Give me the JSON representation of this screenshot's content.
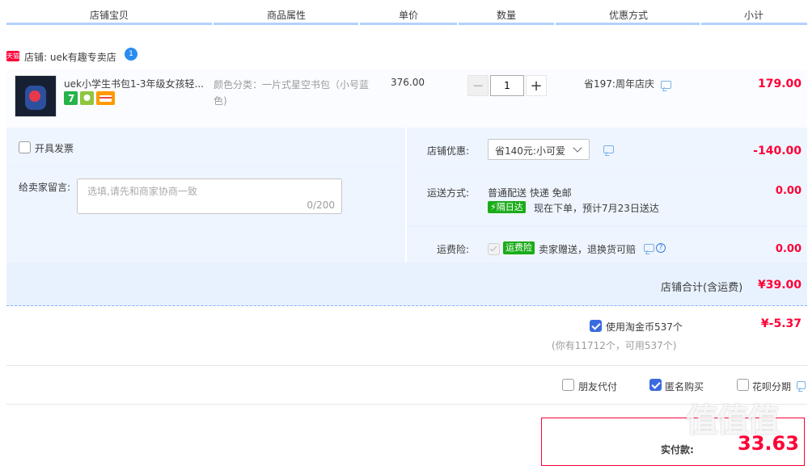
{
  "header": {
    "columns": [
      "店铺宝贝",
      "商品属性",
      "单价",
      "数量",
      "优惠方式",
      "小计"
    ]
  },
  "shop": {
    "badge": "天猫",
    "name": "店铺: uek有趣专卖店",
    "ww_icon": "1"
  },
  "item": {
    "title": "uek小学生书包1-3年级女孩轻...",
    "props": "颜色分类：一片式星空书包（小号蓝色)",
    "price": "376.00",
    "qty_minus": "−",
    "qty_value": "1",
    "qty_plus": "+",
    "promo": "省197:周年店庆",
    "subtotal": "179.00"
  },
  "invoice": {
    "label": "开具发票"
  },
  "message": {
    "label": "给卖家留言:",
    "placeholder": "选填,请先和商家协商一致",
    "counter": "0/200"
  },
  "shop_discount": {
    "label": "店铺优惠:",
    "selected": "省140元:小可爱",
    "amount": "-140.00"
  },
  "shipping": {
    "label": "运送方式:",
    "method": "普通配送 快递 免邮",
    "badge": "隔日达",
    "note": "现在下单，预计7月23日送达",
    "amount": "0.00"
  },
  "insurance": {
    "label": "运费险:",
    "badge": "运费险",
    "text": "卖家赠送，退换货可赔",
    "help": "?",
    "amount": "0.00"
  },
  "shop_total": {
    "label": "店铺合计(含运费)",
    "amount": "¥39.00"
  },
  "coins": {
    "label": "使用淘金币537个",
    "sub": "(你有11712个，可用537个)",
    "amount": "¥-5.37"
  },
  "options": {
    "friend_pay": "朋友代付",
    "anonymous": "匿名购买",
    "huabei": "花呗分期"
  },
  "pay": {
    "label": "实付款:",
    "amount": "33.63"
  },
  "watermark": "值值值",
  "colors": {
    "accent": "#ff0036",
    "blue_bg": "#e8f2ff",
    "checkbox_on": "#3b6ae0"
  }
}
